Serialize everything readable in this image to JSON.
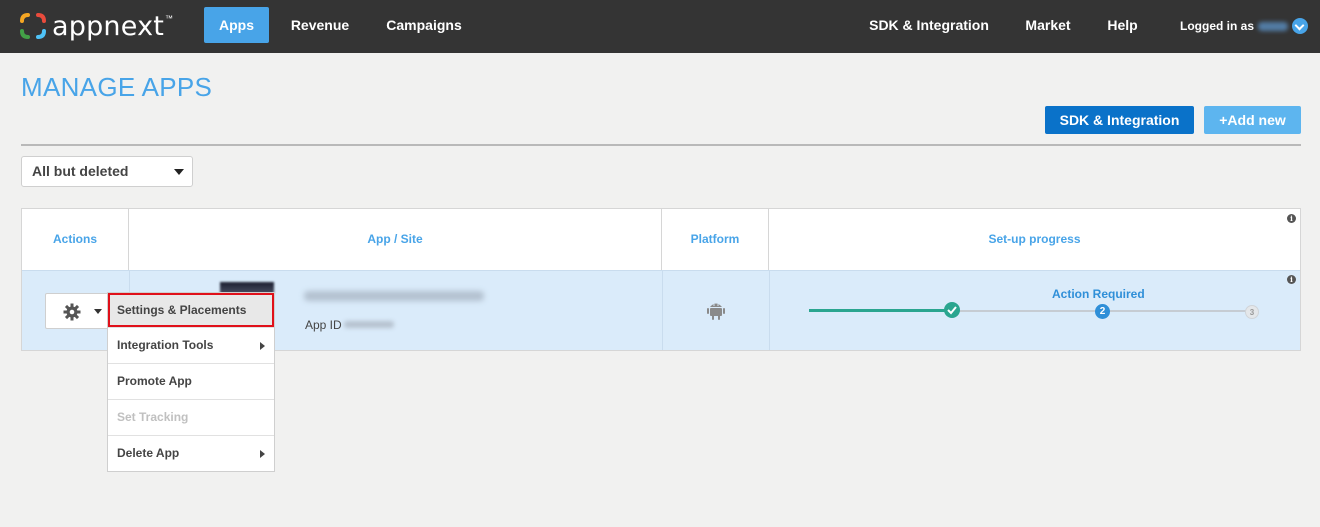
{
  "nav": {
    "logo_text": "appnext",
    "logo_tm": "™",
    "items": [
      {
        "label": "Apps"
      },
      {
        "label": "Revenue"
      },
      {
        "label": "Campaigns"
      },
      {
        "label": "SDK & Integration"
      },
      {
        "label": "Market"
      },
      {
        "label": "Help"
      }
    ],
    "user_label": "Logged in as"
  },
  "page": {
    "title": "MANAGE APPS",
    "sdk_button": "SDK & Integration",
    "add_button": "+Add new",
    "filter_value": "All but deleted"
  },
  "table": {
    "headers": [
      "Actions",
      "App / Site",
      "Platform",
      "Set-up progress"
    ],
    "row": {
      "app_id_label": "App ID",
      "platform_icon": "android-icon",
      "progress_status": "Action Required",
      "steps": [
        "",
        "2",
        "3"
      ],
      "progress_fraction": 0.33
    }
  },
  "menu": {
    "items": [
      {
        "label": "Settings & Placements"
      },
      {
        "label": "Integration Tools"
      },
      {
        "label": "Promote App"
      },
      {
        "label": "Set Tracking"
      },
      {
        "label": "Delete App"
      }
    ]
  },
  "colors": {
    "accent": "#48a4e8",
    "primary_button": "#0a72c9",
    "progress_done": "#2aa58f",
    "highlight_border": "#e0101a",
    "row_selected": "#daebfa"
  }
}
